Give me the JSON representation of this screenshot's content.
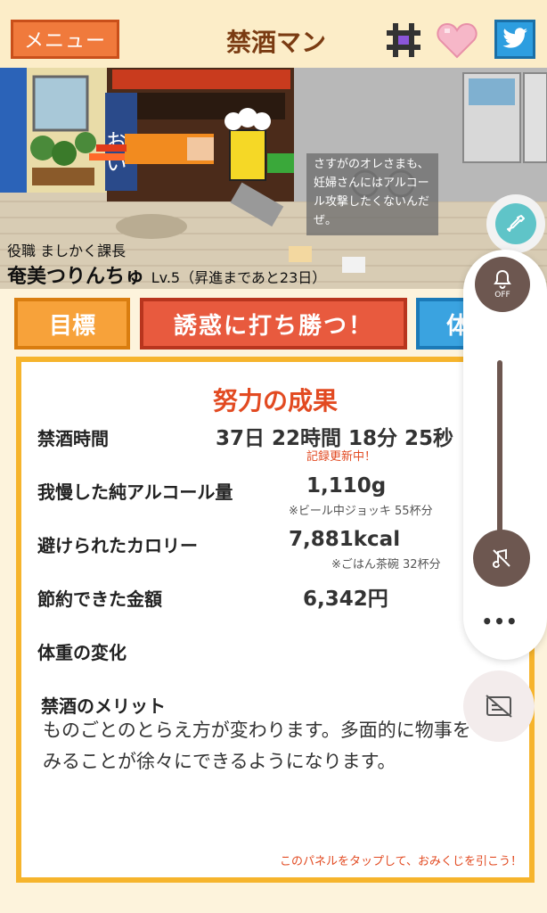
{
  "header": {
    "menu_label": "メニュー",
    "title": "禁酒マン"
  },
  "icons": {
    "hash": "hash-icon",
    "heart": "heart-icon",
    "twitter": "twitter-bird-icon"
  },
  "scene": {
    "speech": "さすがのオレさまも、妊婦さんにはアルコール攻撃したくないんだぜ。",
    "sign_text": "おい",
    "role": "役職 ましかく課長",
    "name": "奄美つりんちゅ",
    "level": "Lv.5（昇進まであと23日）"
  },
  "actions": {
    "goal": "目標",
    "win": "誘惑に打ち勝つ！",
    "third": "体"
  },
  "panel": {
    "title": "努力の成果",
    "rows": {
      "duration_label": "禁酒時間",
      "duration_value": "37日 22時間 18分 25秒",
      "record_note": "記録更新中！",
      "alcohol_label": "我慢した純アルコール量",
      "alcohol_value": "1,110g",
      "alcohol_note": "※ビール中ジョッキ 55杯分",
      "calorie_label": "避けられたカロリー",
      "calorie_value": "7,881kcal",
      "calorie_note": "※ごはん茶碗 32杯分",
      "money_label": "節約できた金額",
      "money_value": "6,342円",
      "weight_label": "体重の変化",
      "merit_label": "禁酒のメリット",
      "merit_text": "ものごとのとらえ方が変わります。多面的に物事をみることが徐々にできるようになります。"
    },
    "tap_hint": "このパネルをタップして、おみくじを引こう！"
  },
  "overlay": {
    "bell_state": "OFF",
    "more": "•••"
  },
  "colors": {
    "menu": "#f07a3c",
    "goal": "#f7a23a",
    "win": "#e85a3e",
    "third": "#3aa3e0",
    "panel_border": "#f6b42c",
    "accent_red": "#e24a21",
    "overlay_brown": "#6d5750"
  }
}
